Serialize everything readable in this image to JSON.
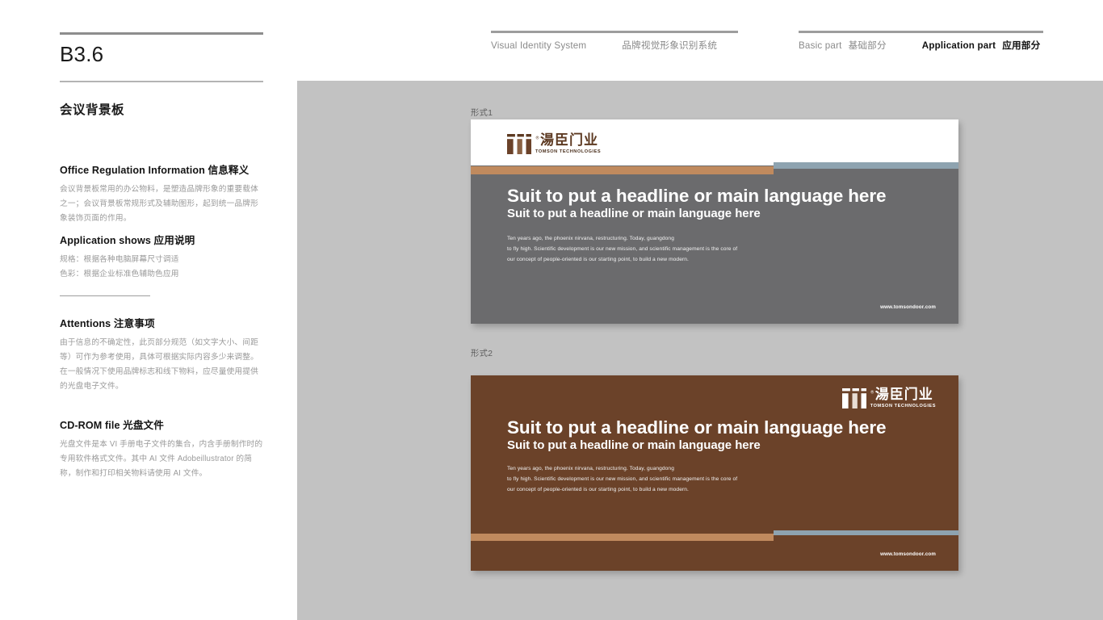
{
  "page": {
    "code": "B3.6",
    "section_title": "会议背景板"
  },
  "nav": {
    "left_group": {
      "system_en": "Visual Identity System",
      "system_cn": "品牌视觉形象识别系统"
    },
    "right_group": {
      "basic_en": "Basic part",
      "basic_cn": "基础部分",
      "application_en": "Application part",
      "application_cn": "应用部分"
    }
  },
  "sidebar": {
    "blocks": [
      {
        "heading": "Office Regulation Information 信息释义",
        "body": "会议背景板常用的办公物料，是塑造品牌形象的重要载体之一；会议背景板常规形式及辅助图形，起到统一品牌形象装饰页面的作用。"
      },
      {
        "heading": "Application shows 应用说明",
        "body_line1": "规格：根据各种电脑屏幕尺寸调适",
        "body_line2": "色彩：根据企业标准色辅助色应用"
      },
      {
        "heading": "Attentions 注意事项",
        "body": "由于信息的不确定性，此页部分规范（如文字大小、间距等）可作为参考使用，具体可根据实际内容多少来调整。在一般情况下使用品牌标志和线下物料，应尽量使用提供的光盘电子文件。"
      },
      {
        "heading": "CD-ROM file 光盘文件",
        "body": "光盘文件是本 VI 手册电子文件的集合，内含手册制作时的专用软件格式文件。其中 AI 文件 Adobeillustrator 的简称，制作和打印相关物料请使用 AI 文件。"
      }
    ]
  },
  "brand": {
    "logo_cn": "湯臣门业",
    "logo_en": "TOMSON TECHNOLOGIES",
    "registered_mark": "®"
  },
  "boards": [
    {
      "label": "形式1",
      "headline_large": "Suit to put a headline or main language here",
      "headline_small": "Suit to put a headline or main language here",
      "paragraph_line1": "Ten years ago, the phoenix nirvana, restructuring. Today, guangdong",
      "paragraph_line2": "to fly high. Scientific development is our new mission,  and scientific management is the core of",
      "paragraph_line3": "our concept of people-oriented is our starting point, to build a new modern.",
      "url": "www.tomsondoor.com"
    },
    {
      "label": "形式2",
      "headline_large": "Suit to put a headline or main language here",
      "headline_small": "Suit to put a headline or main language here",
      "paragraph_line1": "Ten years ago, the phoenix nirvana, restructuring. Today, guangdong",
      "paragraph_line2": "to fly high. Scientific development is our new mission,  and scientific management is the core of",
      "paragraph_line3": "our concept of people-oriented is our starting point, to build a new modern.",
      "url": "www.tomsondoor.com"
    }
  ],
  "colors": {
    "brand_brown": "#6b4229",
    "accent_copper": "#c08a5e",
    "accent_blue_grey": "#8ea3b0",
    "neutral_grey": "#6b6b6d",
    "canvas_grey": "#c2c2c2"
  }
}
